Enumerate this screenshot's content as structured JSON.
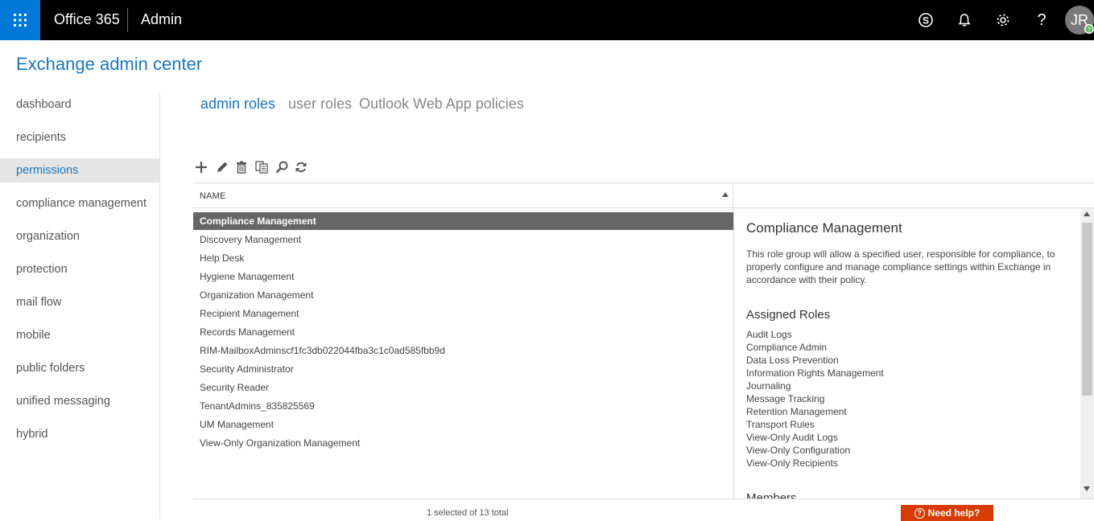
{
  "topbar": {
    "brand": "Office 365",
    "section": "Admin",
    "avatar_initials": "JR",
    "icons": [
      "app-launcher-icon",
      "skype-icon",
      "bell-icon",
      "gear-icon",
      "help-icon"
    ],
    "brand_color": "#0078d7"
  },
  "header": {
    "title": "Exchange admin center"
  },
  "sidebar": {
    "items": [
      {
        "label": "dashboard"
      },
      {
        "label": "recipients"
      },
      {
        "label": "permissions"
      },
      {
        "label": "compliance management"
      },
      {
        "label": "organization"
      },
      {
        "label": "protection"
      },
      {
        "label": "mail flow"
      },
      {
        "label": "mobile"
      },
      {
        "label": "public folders"
      },
      {
        "label": "unified messaging"
      },
      {
        "label": "hybrid"
      }
    ],
    "active_index": 2
  },
  "tabs": [
    {
      "label": "admin roles"
    },
    {
      "label": "user roles"
    },
    {
      "label": "Outlook Web App policies"
    }
  ],
  "toolbar": {
    "icons": [
      "add-icon",
      "edit-icon",
      "delete-icon",
      "copy-icon",
      "search-icon",
      "refresh-icon"
    ]
  },
  "table": {
    "column_name": "NAME",
    "rows": [
      "Compliance Management",
      "Discovery Management",
      "Help Desk",
      "Hygiene Management",
      "Organization Management",
      "Recipient Management",
      "Records Management",
      "RIM-MailboxAdminscf1fc3db022044fba3c1c0ad585fbb9d",
      "Security Administrator",
      "Security Reader",
      "TenantAdmins_835825569",
      "UM Management",
      "View-Only Organization Management"
    ],
    "selected_index": 0,
    "status": "1 selected of 13 total"
  },
  "detail": {
    "title": "Compliance Management",
    "description": "This role group will allow a specified user, responsible for compliance, to properly configure and manage compliance settings within Exchange in accordance with their policy.",
    "assigned_roles_heading": "Assigned Roles",
    "assigned_roles": [
      "Audit Logs",
      "Compliance Admin",
      "Data Loss Prevention",
      "Information Rights Management",
      "Journaling",
      "Message Tracking",
      "Retention Management",
      "Transport Rules",
      "View-Only Audit Logs",
      "View-Only Configuration",
      "View-Only Recipients"
    ],
    "members_heading": "Members"
  },
  "help": {
    "label": "Need help?",
    "color": "#d83b01"
  }
}
